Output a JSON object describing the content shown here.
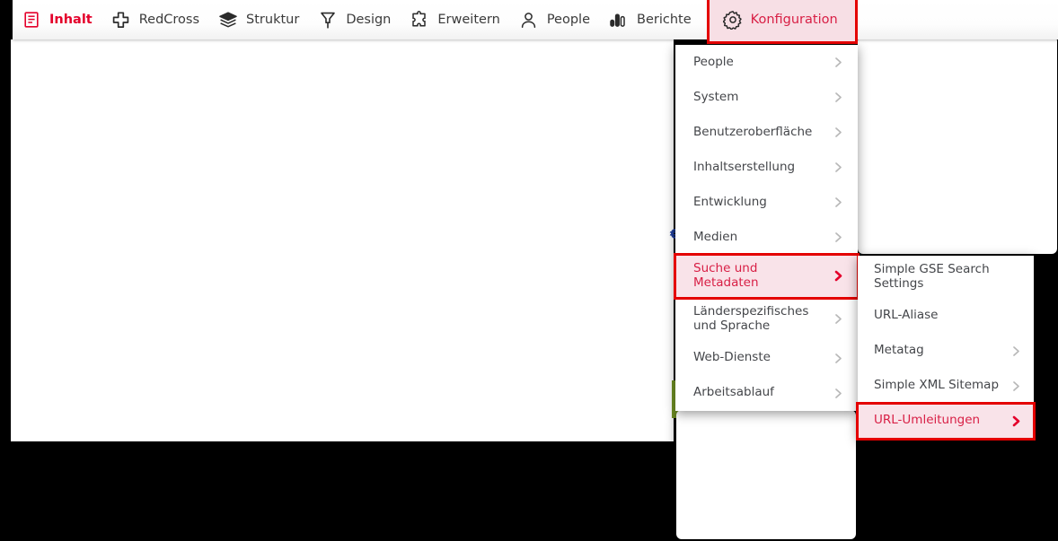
{
  "toolbar": {
    "items": [
      {
        "label": "Inhalt",
        "icon": "content-document-icon",
        "state": "active"
      },
      {
        "label": "RedCross",
        "icon": "cross-plus-icon",
        "state": "normal"
      },
      {
        "label": "Struktur",
        "icon": "layers-icon",
        "state": "normal"
      },
      {
        "label": "Design",
        "icon": "paint-brush-icon",
        "state": "normal"
      },
      {
        "label": "Erweitern",
        "icon": "puzzle-piece-icon",
        "state": "normal"
      },
      {
        "label": "People",
        "icon": "person-icon",
        "state": "normal"
      },
      {
        "label": "Berichte",
        "icon": "bar-chart-icon",
        "state": "normal"
      },
      {
        "label": "Konfiguration",
        "icon": "gear-icon",
        "state": "highlighted"
      }
    ]
  },
  "primary_menu": {
    "items": [
      {
        "label": "People",
        "has_submenu": true,
        "selected": false
      },
      {
        "label": "System",
        "has_submenu": true,
        "selected": false
      },
      {
        "label": "Benutzeroberfläche",
        "has_submenu": true,
        "selected": false
      },
      {
        "label": "Inhaltserstellung",
        "has_submenu": true,
        "selected": false
      },
      {
        "label": "Entwicklung",
        "has_submenu": true,
        "selected": false
      },
      {
        "label": "Medien",
        "has_submenu": true,
        "selected": false
      },
      {
        "label": "Suche und Metadaten",
        "has_submenu": true,
        "selected": true
      },
      {
        "label": "Länderspezifisches und Sprache",
        "has_submenu": true,
        "selected": false
      },
      {
        "label": "Web-Dienste",
        "has_submenu": true,
        "selected": false
      },
      {
        "label": "Arbeitsablauf",
        "has_submenu": true,
        "selected": false
      }
    ]
  },
  "secondary_menu": {
    "items": [
      {
        "label": "Simple GSE Search Settings",
        "has_submenu": false,
        "selected": false
      },
      {
        "label": "URL-Aliase",
        "has_submenu": false,
        "selected": false
      },
      {
        "label": "Metatag",
        "has_submenu": true,
        "selected": false
      },
      {
        "label": "Simple XML Sitemap",
        "has_submenu": true,
        "selected": false
      },
      {
        "label": "URL-Umleitungen",
        "has_submenu": true,
        "selected": true
      }
    ]
  },
  "colors": {
    "brand_red": "#e4002b",
    "highlight_bg": "#f9e3e9",
    "highlight_border": "#e40000",
    "menu_text": "#44464a",
    "page_background": "#000000"
  },
  "panels": {
    "main_content": "",
    "ghost_top_right": "",
    "ghost_bottom": ""
  }
}
